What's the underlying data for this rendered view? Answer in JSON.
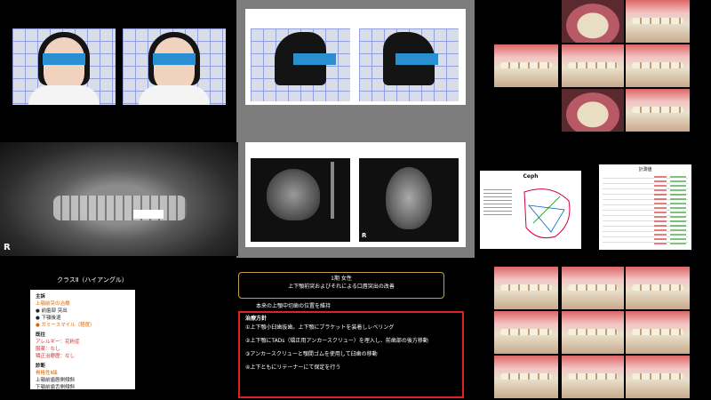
{
  "cards": {
    "patient_title": "クラスⅡ（ハイアングル）",
    "doc_sections": [
      {
        "heading": "主訴",
        "lines": [
          "上顎前突の治療",
          "● 前歯部 突出",
          "● 下顎後退",
          "● ガミースマイル（軽度）"
        ]
      },
      {
        "heading": "既往",
        "lines": [
          "アレルギー：花粉症",
          "服薬：なし",
          "矯正治療歴：なし"
        ]
      },
      {
        "heading": "診断",
        "lines": [
          "骨格性Ⅱ級",
          "上顎前歯唇側傾斜",
          "下顎前歯舌側傾斜"
        ]
      }
    ],
    "ceph_title": "Ceph",
    "table_title": "計測値"
  },
  "xray": {
    "pano_side_label": "R",
    "skull_side_label": "R"
  },
  "summary_box": {
    "line1": "1期 女性",
    "line2": "上下顎前突およびそれによる口唇突出の改善",
    "line3": "本来の上顎中切歯の位置を維持"
  },
  "analysis_box": {
    "title": "治療方針",
    "paragraphs": [
      "①上下顎小臼歯抜歯。上下顎にブラケットを装着しレベリング",
      "②上下顎にTADs（矯正用アンカースクリュー）を埋入し、前歯部の後方移動",
      "③アンカースクリューと顎間ゴムを使用して臼歯の移動",
      "④上下ともにリテーナーにて保定を行う"
    ]
  },
  "colors": {
    "frame_red": "#dd2222",
    "frame_gold": "#c8a04a",
    "background": "#000000"
  }
}
